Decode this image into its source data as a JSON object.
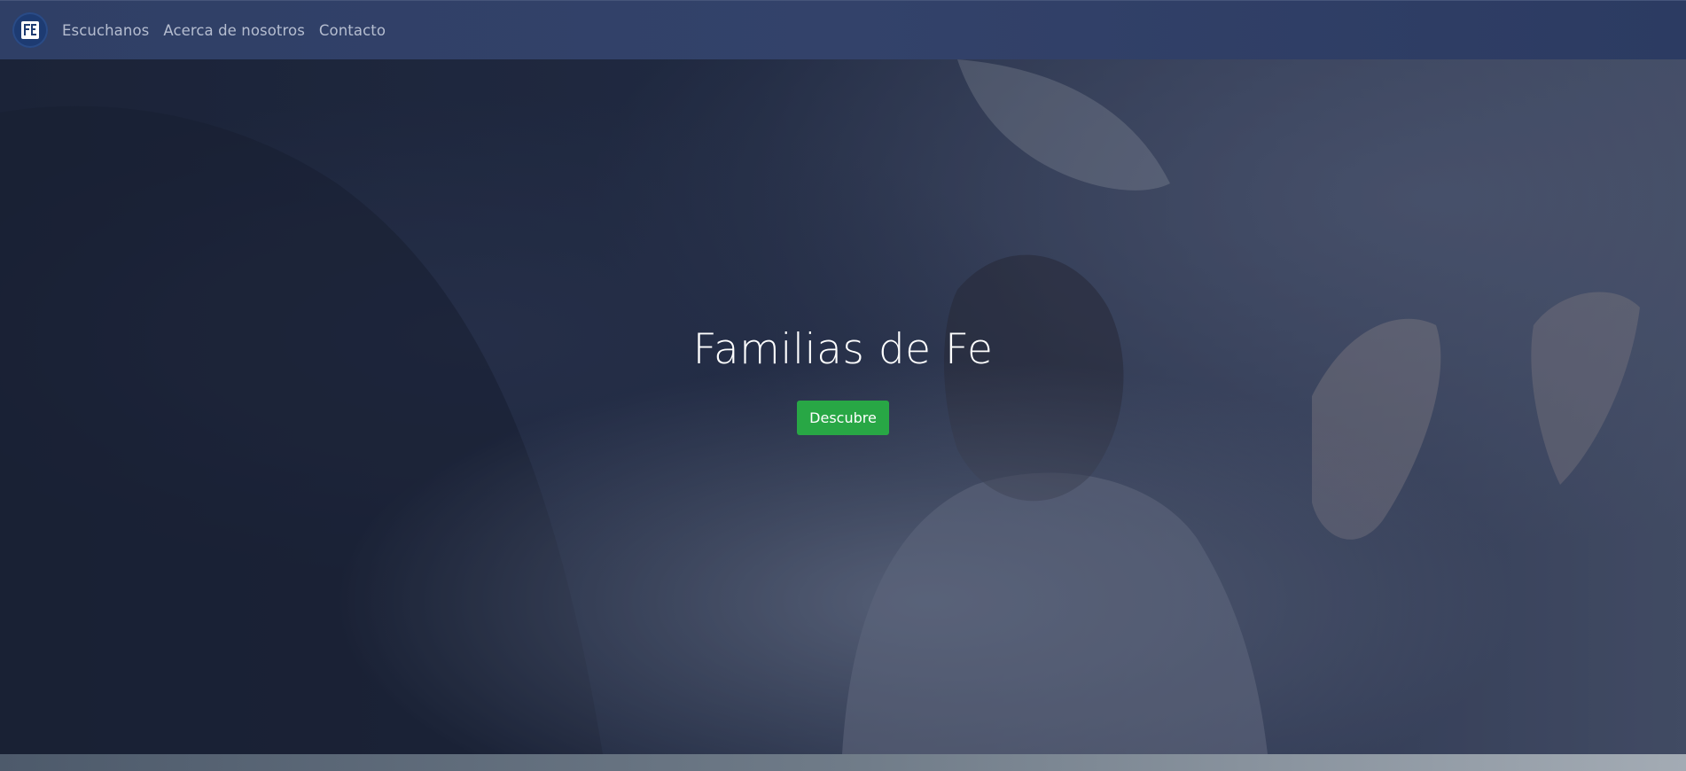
{
  "navbar": {
    "logo": {
      "text": "FE",
      "icon": "church-logo-icon",
      "bg_color": "#1d3b72"
    },
    "links": [
      {
        "label": "Escuchanos"
      },
      {
        "label": "Acerca de nosotros"
      },
      {
        "label": "Contacto"
      }
    ]
  },
  "hero": {
    "title": "Familias de Fe",
    "cta_label": "Descubre",
    "cta_color": "#28a745",
    "background": "worship-photo"
  }
}
